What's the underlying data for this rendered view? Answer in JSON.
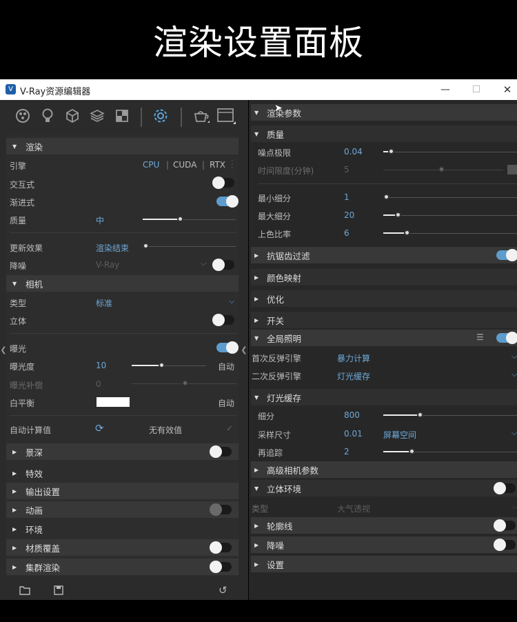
{
  "banner": {
    "title": "渲染设置面板"
  },
  "window": {
    "title": "V-Ray资源编辑器",
    "minimize": "—",
    "maximize": "☐",
    "close": "✕"
  },
  "toolbar": {
    "icons": [
      "materials-icon",
      "lights-icon",
      "geometry-icon",
      "layers-icon",
      "textures-icon",
      "settings-icon",
      "render-icon",
      "frame-buffer-icon"
    ]
  },
  "left": {
    "render": {
      "label": "渲染",
      "engine": {
        "label": "引擎",
        "options": [
          "CPU",
          "CUDA",
          "RTX"
        ]
      },
      "interactive": {
        "label": "交互式"
      },
      "progressive": {
        "label": "渐进式"
      },
      "quality": {
        "label": "质量",
        "value": "中"
      },
      "update": {
        "label": "更新效果",
        "value": "渲染结束"
      },
      "denoise": {
        "label": "降噪",
        "value": "V-Ray"
      }
    },
    "camera": {
      "label": "相机",
      "type": {
        "label": "类型",
        "value": "标准"
      },
      "stereo": {
        "label": "立体"
      },
      "exposure": {
        "label": "曝光"
      },
      "exposure_value": {
        "label": "曝光度",
        "value": "10",
        "auto": "自动"
      },
      "exposure_comp": {
        "label": "曝光补偿",
        "value": "0"
      },
      "white_balance": {
        "label": "白平衡",
        "auto": "自动"
      },
      "auto_calc": {
        "label": "自动计算值",
        "status": "无有效值"
      }
    },
    "collapsed": [
      {
        "label": "景深"
      },
      {
        "label": "特效"
      },
      {
        "label": "输出设置"
      },
      {
        "label": "动画"
      },
      {
        "label": "环境"
      },
      {
        "label": "材质覆盖"
      },
      {
        "label": "集群渲染"
      }
    ]
  },
  "right": {
    "render_params": {
      "label": "渲染参数"
    },
    "quality": {
      "label": "质量",
      "noise_limit": {
        "label": "噪点极限",
        "value": "0.04"
      },
      "time_limit": {
        "label": "时间限度(分钟)",
        "value": "5"
      },
      "min_subdiv": {
        "label": "最小细分",
        "value": "1"
      },
      "max_subdiv": {
        "label": "最大细分",
        "value": "20"
      },
      "shading_rate": {
        "label": "上色比率",
        "value": "6"
      }
    },
    "antialias": {
      "label": "抗锯齿过滤"
    },
    "color_mapping": {
      "label": "颜色映射"
    },
    "optimize": {
      "label": "优化"
    },
    "switches": {
      "label": "开关"
    },
    "gi": {
      "label": "全局照明",
      "primary": {
        "label": "首次反弹引擎",
        "value": "暴力计算"
      },
      "secondary": {
        "label": "二次反弹引擎",
        "value": "灯光缓存"
      }
    },
    "light_cache": {
      "label": "灯光缓存",
      "subdivs": {
        "label": "细分",
        "value": "800"
      },
      "sample_size": {
        "label": "采样尺寸",
        "value": "0.01",
        "mode": "屏幕空间"
      },
      "retrace": {
        "label": "再追踪",
        "value": "2"
      }
    },
    "adv_camera": {
      "label": "高级相机参数"
    },
    "volumetric": {
      "label": "立体环境",
      "type_label": "类型",
      "type_value": "大气透视"
    },
    "contours": {
      "label": "轮廓线"
    },
    "denoiser": {
      "label": "降噪"
    },
    "settings": {
      "label": "设置"
    }
  }
}
